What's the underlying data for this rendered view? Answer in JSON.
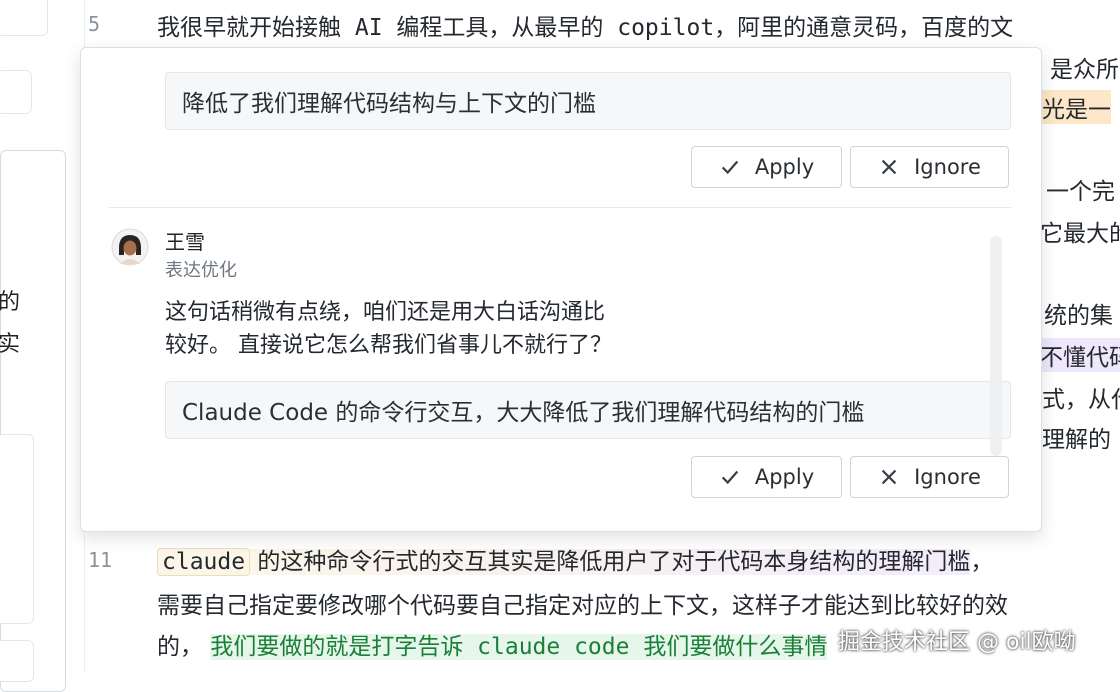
{
  "editor": {
    "line5": {
      "num": "5",
      "text": "我很早就开始接触 AI 编程工具，从最早的 copilot，阿里的通意灵码，百度的文"
    },
    "right_fragments": [
      {
        "text": "是众所",
        "style": "plain"
      },
      {
        "text": "光是一",
        "style": "orange"
      },
      {
        "text": "一个完",
        "style": "plain"
      },
      {
        "text": "它最大的",
        "style": "plain"
      },
      {
        "text": "统的集",
        "style": "plain"
      },
      {
        "text": "不懂代码",
        "style": "purple"
      },
      {
        "text": "式，从代",
        "style": "plain"
      },
      {
        "text": "理解的",
        "style": "plain"
      }
    ],
    "line11": {
      "num": "11",
      "code": "claude",
      "rest": " 的这种命令行式的交互其实是降低用户了对于代码本身结构的理解门槛",
      "tail": "，"
    },
    "line12": "需要自己指定要修改哪个代码要自己指定对应的上下文，这样子才能达到比较好的效",
    "line13": {
      "prefix": "的，",
      "green": "我们要做的就是打字告诉 claude code 我们要做什么事情"
    }
  },
  "sidebar": {
    "frag1": "的",
    "frag2": "实"
  },
  "popup": {
    "suggestion1": {
      "text": "降低了我们理解代码结构与上下文的门槛",
      "apply_label": "Apply",
      "ignore_label": "Ignore"
    },
    "comment": {
      "author": "王雪",
      "category": "表达优化",
      "text_line1": "这句话稍微有点绕，咱们还是用大白话沟通比",
      "text_line2": "较好。 直接说它怎么帮我们省事儿不就行了？",
      "suggestion": "Claude Code 的命令行交互，大大降低了我们理解代码结构的门槛",
      "apply_label": "Apply",
      "ignore_label": "Ignore"
    }
  },
  "watermark": "掘金技术社区 @ oil欧呦",
  "icons": {
    "apply": "check-icon",
    "ignore": "close-icon",
    "avatar": "user-avatar"
  },
  "colors": {
    "orange_highlight": "#fde7c8",
    "purple_highlight": "#efe7fb",
    "green_highlight": "#e6f6ea"
  }
}
